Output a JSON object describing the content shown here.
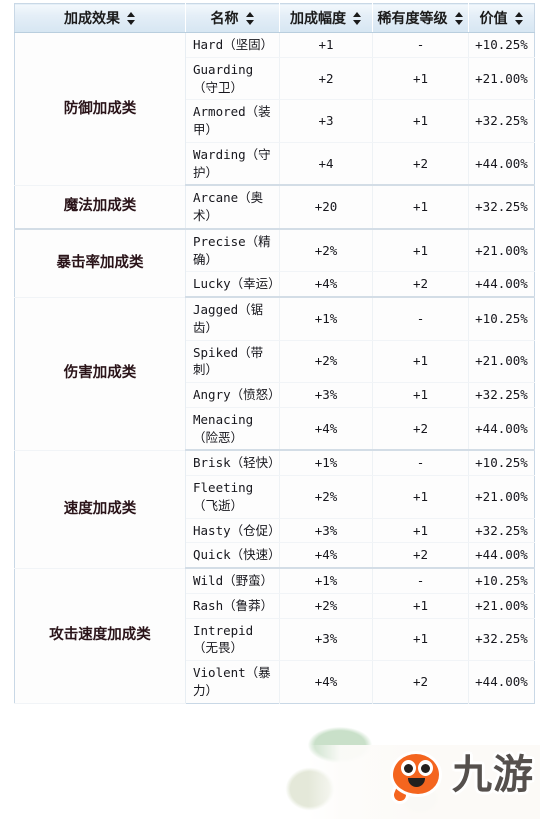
{
  "table": {
    "columns": [
      {
        "label": "加成效果",
        "sortable": true
      },
      {
        "label": "名称",
        "sortable": true
      },
      {
        "label": "加成幅度",
        "sortable": true
      },
      {
        "label": "稀有度等级",
        "sortable": true
      },
      {
        "label": "价值",
        "sortable": true
      }
    ],
    "sections": [
      {
        "category": "防御加成类",
        "rows": [
          {
            "name": "Hard（坚固）",
            "amount": "+1",
            "rarity": "-",
            "value": "+10.25%"
          },
          {
            "name": "Guarding（守卫）",
            "amount": "+2",
            "rarity": "+1",
            "value": "+21.00%"
          },
          {
            "name": "Armored（装甲）",
            "amount": "+3",
            "rarity": "+1",
            "value": "+32.25%"
          },
          {
            "name": "Warding（守护）",
            "amount": "+4",
            "rarity": "+2",
            "value": "+44.00%"
          }
        ]
      },
      {
        "category": "魔法加成类",
        "rows": [
          {
            "name": "Arcane（奥术）",
            "amount": "+20",
            "rarity": "+1",
            "value": "+32.25%"
          }
        ]
      },
      {
        "category": "暴击率加成类",
        "rows": [
          {
            "name": "Precise（精确）",
            "amount": "+2%",
            "rarity": "+1",
            "value": "+21.00%"
          },
          {
            "name": "Lucky（幸运）",
            "amount": "+4%",
            "rarity": "+2",
            "value": "+44.00%"
          }
        ]
      },
      {
        "category": "伤害加成类",
        "rows": [
          {
            "name": "Jagged（锯齿）",
            "amount": "+1%",
            "rarity": "-",
            "value": "+10.25%"
          },
          {
            "name": "Spiked（带刺）",
            "amount": "+2%",
            "rarity": "+1",
            "value": "+21.00%"
          },
          {
            "name": "Angry（愤怒）",
            "amount": "+3%",
            "rarity": "+1",
            "value": "+32.25%"
          },
          {
            "name": "Menacing（险恶）",
            "amount": "+4%",
            "rarity": "+2",
            "value": "+44.00%"
          }
        ]
      },
      {
        "category": "速度加成类",
        "rows": [
          {
            "name": "Brisk（轻快）",
            "amount": "+1%",
            "rarity": "-",
            "value": "+10.25%"
          },
          {
            "name": "Fleeting（飞逝）",
            "amount": "+2%",
            "rarity": "+1",
            "value": "+21.00%"
          },
          {
            "name": "Hasty（仓促）",
            "amount": "+3%",
            "rarity": "+1",
            "value": "+32.25%"
          },
          {
            "name": "Quick（快速）",
            "amount": "+4%",
            "rarity": "+2",
            "value": "+44.00%"
          }
        ]
      },
      {
        "category": "攻击速度加成类",
        "rows": [
          {
            "name": "Wild（野蛮）",
            "amount": "+1%",
            "rarity": "-",
            "value": "+10.25%"
          },
          {
            "name": "Rash（鲁莽）",
            "amount": "+2%",
            "rarity": "+1",
            "value": "+21.00%"
          },
          {
            "name": "Intrepid（无畏）",
            "amount": "+3%",
            "rarity": "+1",
            "value": "+32.25%"
          },
          {
            "name": "Violent（暴力）",
            "amount": "+4%",
            "rarity": "+2",
            "value": "+44.00%"
          }
        ]
      }
    ]
  },
  "watermark": {
    "text": "九游",
    "mascot_color": "#f4651f",
    "text_color": "#55504d"
  },
  "colors": {
    "header_bg": "#d6e6f2",
    "header_text": "#1b1b1b",
    "category_text": "#2a1419",
    "body_text": "#17171d",
    "border": "#c9d8e6"
  }
}
